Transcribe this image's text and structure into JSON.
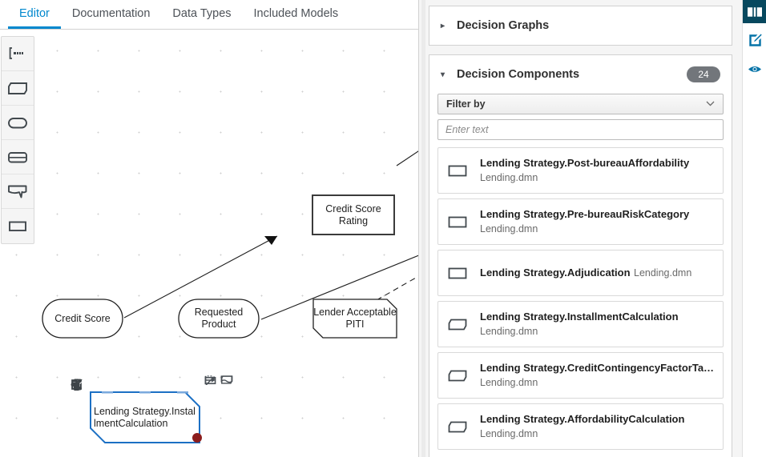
{
  "tabs": [
    {
      "label": "Editor",
      "active": true
    },
    {
      "label": "Documentation",
      "active": false
    },
    {
      "label": "Data Types",
      "active": false
    },
    {
      "label": "Included Models",
      "active": false
    }
  ],
  "palette": [
    {
      "name": "select-tool",
      "icon": "lasso-icon"
    },
    {
      "name": "bkm-tool",
      "icon": "business-knowledge-model-icon"
    },
    {
      "name": "input-data-tool",
      "icon": "input-data-icon"
    },
    {
      "name": "knowledge-source-tool",
      "icon": "knowledge-source-icon"
    },
    {
      "name": "text-annotation-tool",
      "icon": "text-annotation-icon"
    },
    {
      "name": "decision-tool",
      "icon": "decision-icon"
    }
  ],
  "canvas": {
    "nodes": [
      {
        "id": "credit-score",
        "label": "Credit Score",
        "shape": "input-data"
      },
      {
        "id": "requested-product",
        "label": "Requested Product",
        "shape": "input-data"
      },
      {
        "id": "lender-acceptable-piti",
        "label": "Lender Acceptable PITI",
        "shape": "business-knowledge-model"
      },
      {
        "id": "credit-score-rating",
        "label": "Credit Score Rating",
        "shape": "decision"
      },
      {
        "id": "lending-strategy-installment-calculation",
        "label": "Lending Strategy.InstallmentCalculation",
        "shape": "business-knowledge-model",
        "selected": true
      }
    ],
    "selection_color": "#1c70c4",
    "resize_handle_color": "#8b1d1d"
  },
  "node_toolbar_left": [
    {
      "name": "delete-node-button",
      "icon": "trash-icon"
    },
    {
      "name": "edit-node-button",
      "icon": "pencil-square-icon"
    },
    {
      "name": "share-node-button",
      "icon": "share-icon"
    }
  ],
  "node_toolbar_right": [
    {
      "name": "add-text-annotation-button",
      "icon": "text-annotation-icon"
    },
    {
      "name": "add-bkm-button",
      "icon": "business-knowledge-model-icon"
    },
    {
      "name": "add-knowledge-source-button",
      "icon": "knowledge-source-icon"
    },
    {
      "name": "create-connection-button",
      "icon": "arrow-connection-icon"
    },
    {
      "name": "add-decision-button",
      "icon": "decision-icon"
    }
  ],
  "sidebar": {
    "decision_graphs": {
      "title": "Decision Graphs",
      "expanded": false,
      "caret": "▸"
    },
    "decision_components": {
      "title": "Decision Components",
      "count": "24",
      "expanded": true,
      "caret": "▾",
      "filter": {
        "label": "Filter by",
        "chevron": "∨"
      },
      "search": {
        "value": "",
        "placeholder": "Enter text"
      },
      "items": [
        {
          "title": "Lending Strategy.Post-bureauAffordability",
          "subtitle": "Lending.dmn",
          "icon": "decision-icon"
        },
        {
          "title": "Lending Strategy.Pre-bureauRiskCategory",
          "subtitle": "Lending.dmn",
          "icon": "decision-icon"
        },
        {
          "title": "Lending Strategy.Adjudication",
          "subtitle": "Lending.dmn",
          "icon": "decision-icon"
        },
        {
          "title": "Lending Strategy.InstallmentCalculation",
          "subtitle": "Lending.dmn",
          "icon": "business-knowledge-model-icon"
        },
        {
          "title": "Lending Strategy.CreditContingencyFactorTa…",
          "subtitle": "Lending.dmn",
          "icon": "business-knowledge-model-icon"
        },
        {
          "title": "Lending Strategy.AffordabilityCalculation",
          "subtitle": "Lending.dmn",
          "icon": "business-knowledge-model-icon"
        }
      ]
    }
  },
  "rail": [
    {
      "name": "rail-button-overview",
      "icon": "map-icon",
      "active": true
    },
    {
      "name": "rail-button-properties",
      "icon": "pencil-square-icon",
      "active": false
    },
    {
      "name": "rail-button-preview",
      "icon": "eye-icon",
      "active": false
    }
  ],
  "colors": {
    "accent": "#0088ce",
    "rail_active_bg": "#07485e",
    "badge_bg": "#72767b",
    "panel_bg": "#f5f5f5"
  }
}
